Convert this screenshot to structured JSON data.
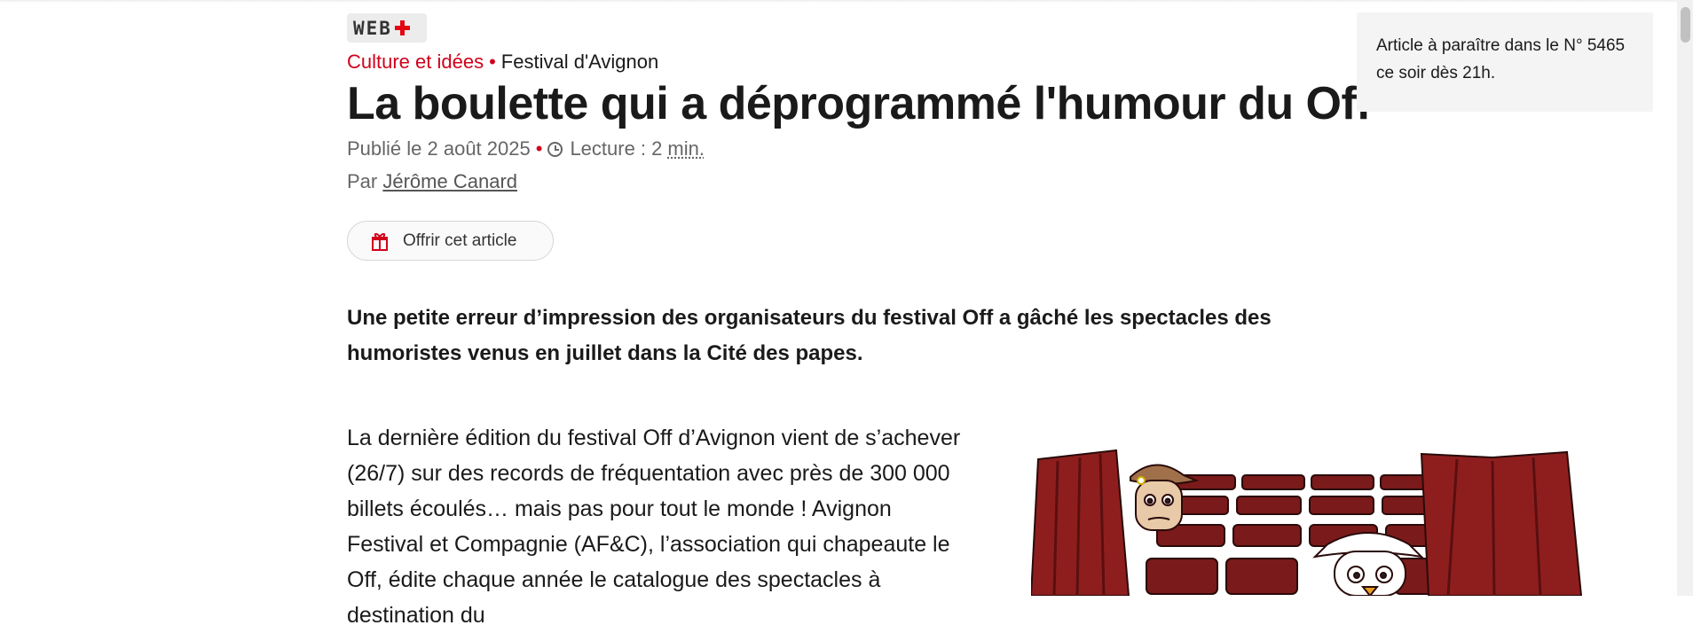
{
  "badge": {
    "web_text": "WEB"
  },
  "kicker": {
    "rubrique": "Culture et idées",
    "separator": "•",
    "sub": "Festival d'Avignon"
  },
  "article": {
    "title": "La boulette qui a déprogrammé l'humour du Off",
    "published": "Publié le 2 août 2025",
    "separator": "•",
    "reading_label": "Lecture : 2",
    "reading_unit": "min.",
    "byline_prefix": "Par",
    "author": "Jérôme Canard",
    "offer_label": "Offrir cet article",
    "lead": "Une petite erreur d’impression des organisateurs du festival Off a gâché les spectacles des humoristes venus en juillet dans la Cité des papes.",
    "body": "La dernière édition du festival Off d’Avignon vient de s’achever (26/7) sur des records de fréquentation avec près de 300 000 billets écoulés… mais pas pour tout le monde ! Avignon Festival et Compagnie (AF&C), l’association qui chapeaute le Off, édite chaque année le catalogue des spectacles à destination du"
  },
  "sidebar": {
    "notice": "Article à paraître dans le N° 5465 ce soir dès 21h."
  },
  "icons": {
    "badge_cross": "red-cross-icon",
    "clock": "clock-icon",
    "gift": "gift-icon"
  },
  "colors": {
    "accent": "#d0021b",
    "text": "#1a1a1a",
    "muted": "#666666",
    "sidebar_bg": "#f4f4f4",
    "curtain": "#8e1e1e",
    "seats": "#7a1a1a"
  }
}
